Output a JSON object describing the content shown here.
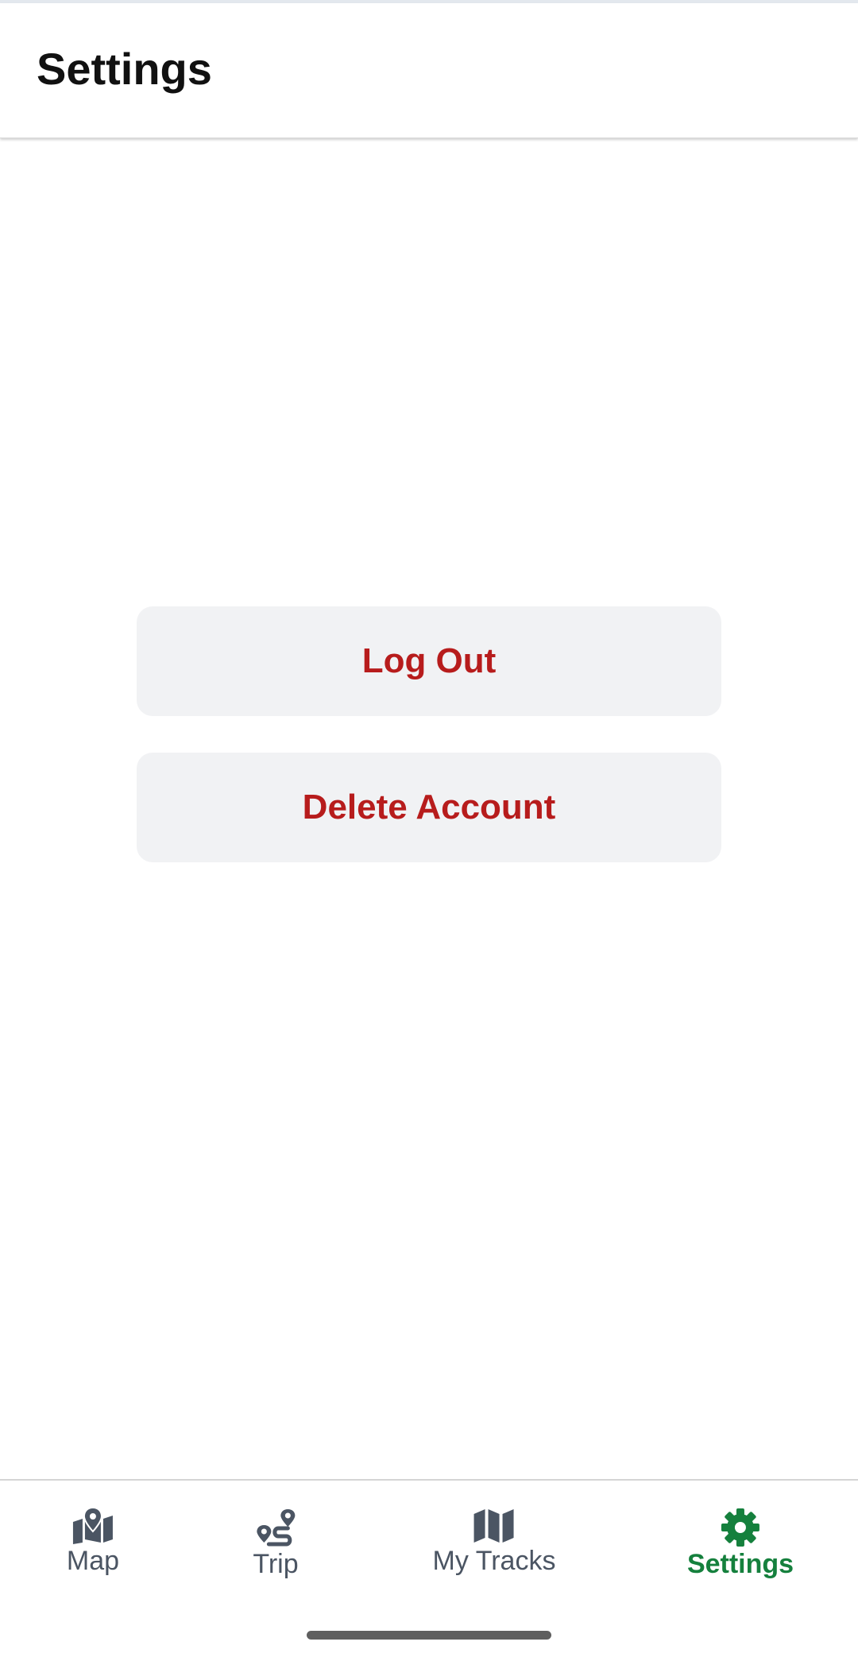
{
  "header": {
    "title": "Settings"
  },
  "actions": {
    "logout_label": "Log Out",
    "delete_account_label": "Delete Account"
  },
  "tabs": [
    {
      "label": "Map",
      "icon": "map-pin-icon",
      "active": false
    },
    {
      "label": "Trip",
      "icon": "route-icon",
      "active": false
    },
    {
      "label": "My Tracks",
      "icon": "folded-map-icon",
      "active": false
    },
    {
      "label": "Settings",
      "icon": "gear-icon",
      "active": true
    }
  ],
  "colors": {
    "danger_text": "#b71c1c",
    "button_bg": "#f1f2f4",
    "tab_inactive": "#4b5563",
    "tab_active": "#15803d"
  }
}
